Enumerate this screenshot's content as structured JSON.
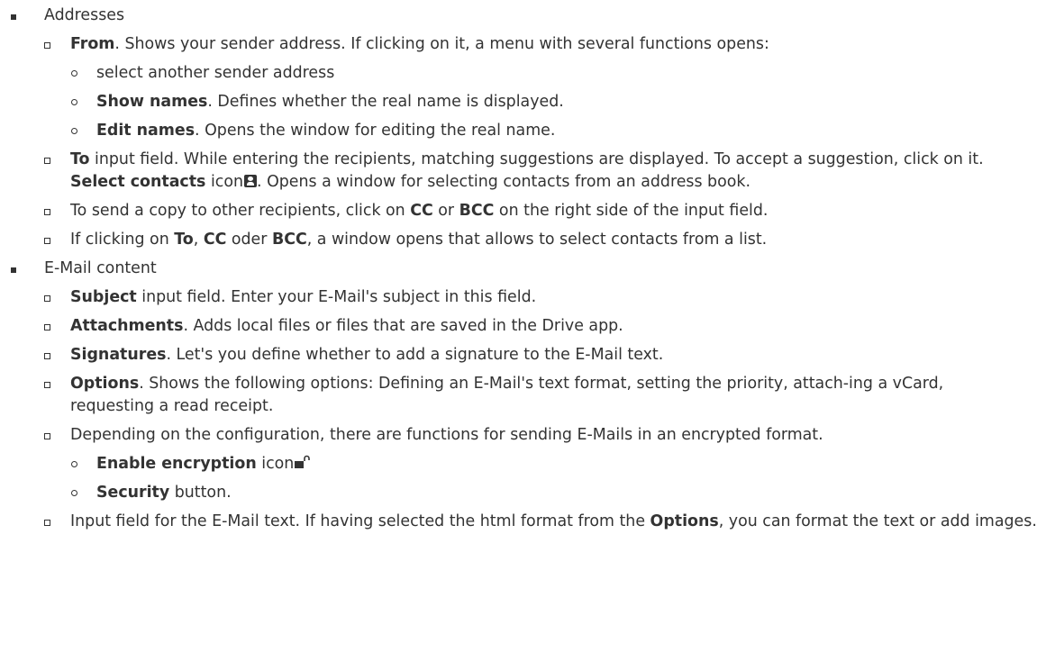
{
  "sections": {
    "addresses": {
      "label": "Addresses",
      "from": {
        "term": "From",
        "text": ". Shows your sender address. If clicking on it, a menu with several functions opens:",
        "items": {
          "select_other": "select another sender address",
          "show_names_term": "Show names",
          "show_names_text": ". Defines whether the real name is displayed.",
          "edit_names_term": "Edit names",
          "edit_names_text": ". Opens the window for editing the real name."
        }
      },
      "to": {
        "term": "To",
        "text": " input field. While entering the recipients, matching suggestions are displayed. To accept a suggestion, click on it.",
        "select_contacts_term": "Select contacts",
        "select_contacts_icon_word": " icon",
        "select_contacts_text": ". Opens a window for selecting contacts from an address book."
      },
      "cc_bcc": {
        "text_before": "To send a copy to other recipients, click on ",
        "cc": "CC",
        "or": " or ",
        "bcc": "BCC",
        "text_after": " on the right side of the input field."
      },
      "to_cc_bcc": {
        "text_before": "If clicking on ",
        "to": "To",
        "comma": ", ",
        "cc": "CC",
        "oder": " oder ",
        "bcc": "BCC",
        "text_after": ", a window opens that allows to select contacts from a list."
      }
    },
    "content": {
      "label": "E-Mail content",
      "subject_term": "Subject",
      "subject_text": " input field. Enter your E-Mail's subject in this field.",
      "attachments_term": "Attachments",
      "attachments_text": ". Adds local files or files that are saved in the Drive app.",
      "signatures_term": "Signatures",
      "signatures_text": ". Let's you define whether to add a signature to the E-Mail text.",
      "options_term": "Options",
      "options_text": ". Shows the following options: Defining an E-Mail's text format, setting the priority, attach-ing a vCard, requesting a read receipt.",
      "encryption_text": "Depending on the configuration, there are functions for sending E-Mails in an encrypted format.",
      "enable_encryption_term": "Enable encryption",
      "enable_encryption_icon_word": " icon",
      "security_term": "Security",
      "security_text": " button.",
      "input_text_before": "Input field for the E-Mail text. If having selected the html format from the ",
      "input_options_term": "Options",
      "input_text_after": ", you can format the text or add images."
    }
  },
  "icons": {
    "contacts": "address-book-icon",
    "lock": "unlock-icon"
  }
}
